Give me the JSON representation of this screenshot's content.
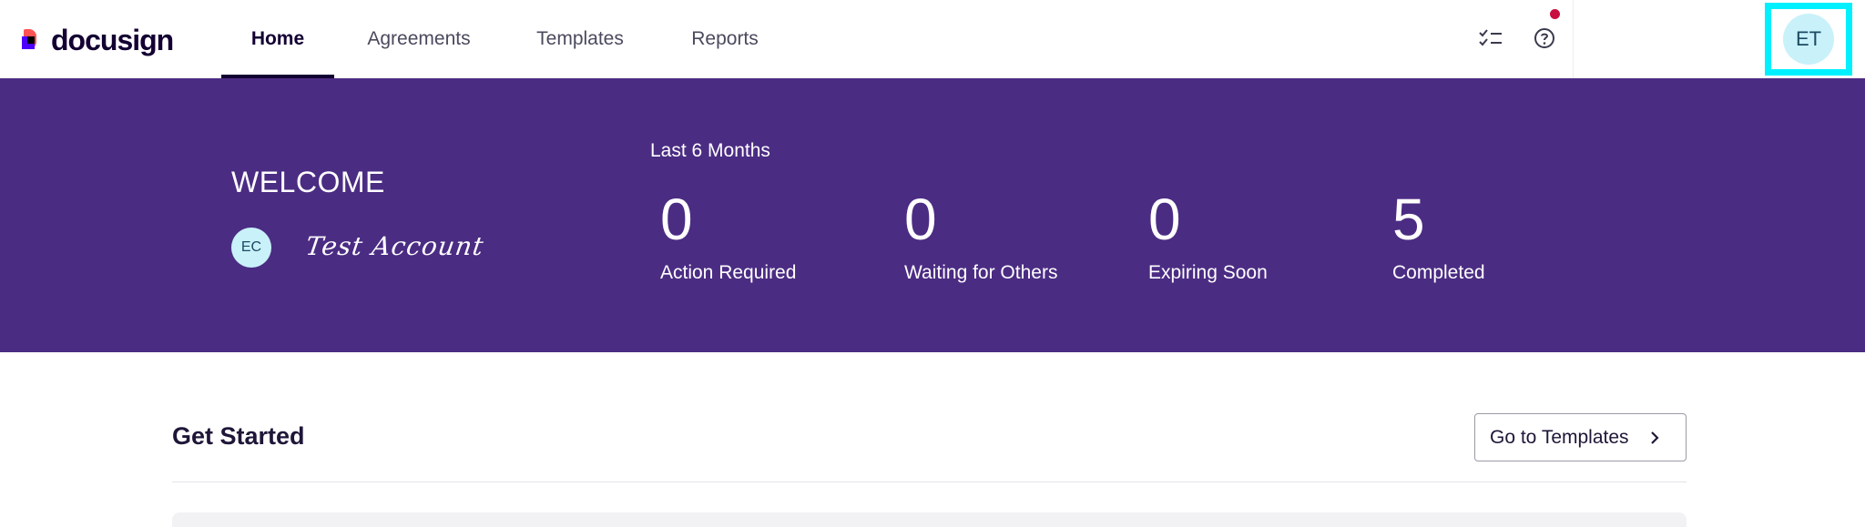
{
  "header": {
    "logo_text": "docusign",
    "nav": [
      {
        "label": "Home",
        "active": true
      },
      {
        "label": "Agreements",
        "active": false
      },
      {
        "label": "Templates",
        "active": false
      },
      {
        "label": "Reports",
        "active": false
      }
    ],
    "icons": [
      "tasks-icon",
      "help-icon"
    ],
    "user_initials": "ET",
    "notification_color": "#c8103e"
  },
  "banner": {
    "welcome": "WELCOME",
    "user_initials": "EC",
    "signature": "Test Account",
    "period_label": "Last 6 Months",
    "stats": [
      {
        "value": "0",
        "label": "Action Required"
      },
      {
        "value": "0",
        "label": "Waiting for Others"
      },
      {
        "value": "0",
        "label": "Expiring Soon"
      },
      {
        "value": "5",
        "label": "Completed"
      }
    ],
    "background_color": "#4b2c83"
  },
  "main": {
    "section_title": "Get Started",
    "templates_button": "Go to Templates"
  },
  "colors": {
    "highlight": "#00f0ff",
    "avatar_bg": "#c9f1fa"
  }
}
